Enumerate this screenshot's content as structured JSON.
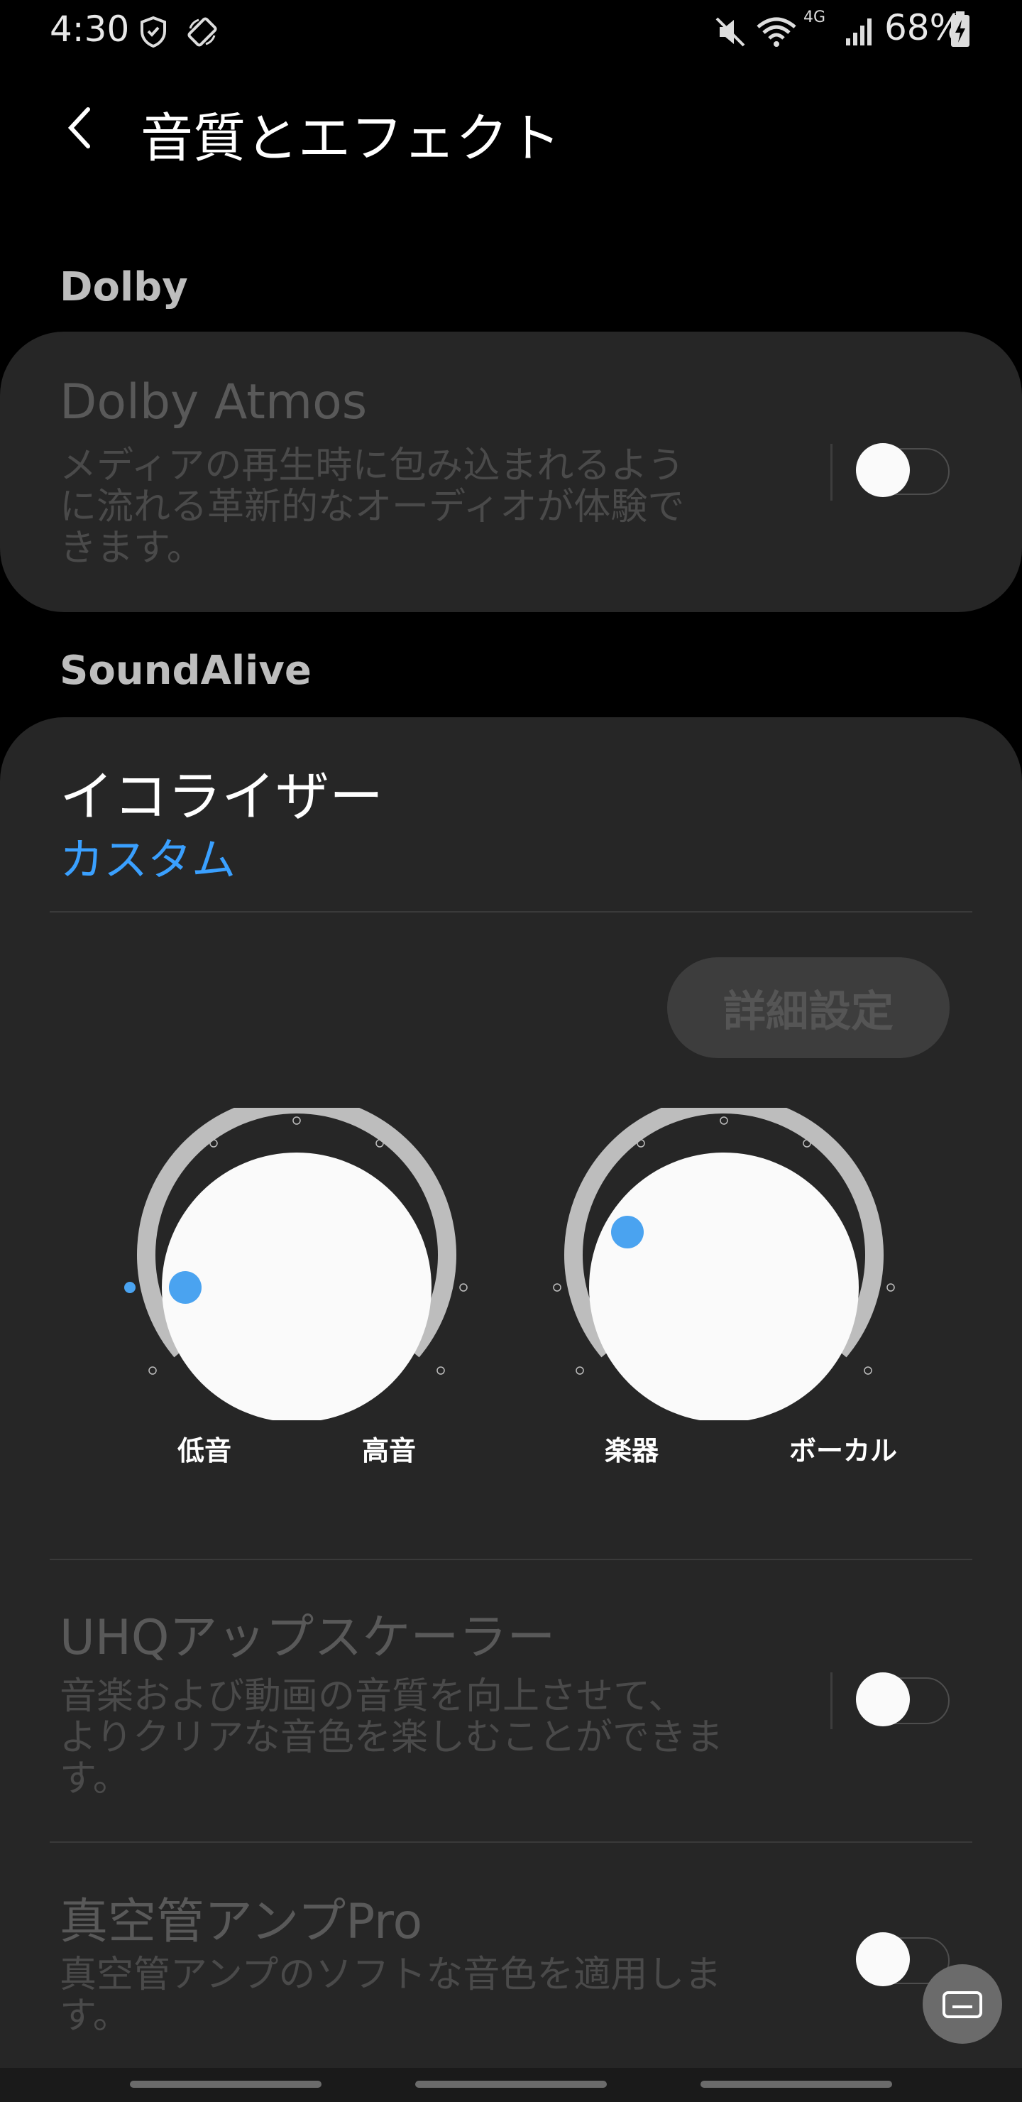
{
  "status_bar": {
    "time": "4:30",
    "network": "4G",
    "battery": "68%"
  },
  "header": {
    "title": "音質とエフェクト"
  },
  "dolby": {
    "section_label": "Dolby",
    "atmos_title": "Dolby Atmos",
    "atmos_desc_lines": [
      "メディアの再生時に包み込まれるよう",
      "に流れる革新的なオーディオが体験で",
      "きます。"
    ],
    "atmos_enabled": false
  },
  "soundalive": {
    "section_label": "SoundAlive",
    "equalizer_title": "イコライザー",
    "equalizer_value": "カスタム",
    "detail_button": "詳細設定",
    "knobs": [
      {
        "left_label": "低音",
        "right_label": "高音"
      },
      {
        "left_label": "楽器",
        "right_label": "ボーカル"
      }
    ],
    "uhq_title": "UHQアップスケーラー",
    "uhq_desc_lines": [
      "音楽および動画の音質を向上させて、",
      "よりクリアな音色を楽しむことができま",
      "す。"
    ],
    "uhq_enabled": false,
    "tube_title": "真空管アンプPro",
    "tube_desc_lines": [
      "真空管アンプのソフトな音色を適用しま",
      "す。"
    ],
    "tube_enabled": false
  },
  "colors": {
    "accent": "#3aa0ff",
    "knob_dot": "#4aa3f0",
    "background": "#000000",
    "card": "#262626"
  },
  "icons": [
    "back-icon",
    "shield-icon",
    "rotate-icon",
    "mute-icon",
    "wifi-icon",
    "signal-icon",
    "battery-icon",
    "keyboard-icon"
  ]
}
